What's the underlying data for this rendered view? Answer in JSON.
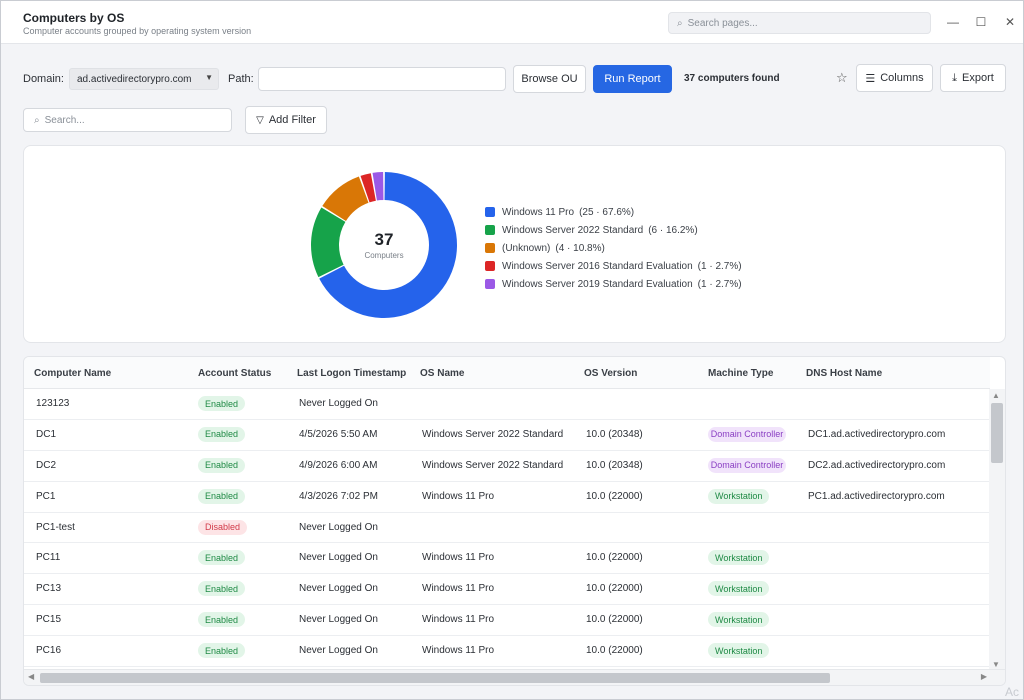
{
  "window": {
    "title": "Computers by OS",
    "subtitle": "Computer accounts grouped by operating system version",
    "search_placeholder": "Search pages...",
    "controls": {
      "minimize": "—",
      "maximize": "☐",
      "close": "✕"
    }
  },
  "toolbar": {
    "domain_label": "Domain:",
    "domain_value": "ad.activedirectorypro.com",
    "path_label": "Path:",
    "path_value": "",
    "browse_label": "Browse OU",
    "run_label": "Run Report",
    "found_text": "37 computers found",
    "columns_label": "Columns",
    "export_label": "Export",
    "search_placeholder": "Search...",
    "add_filter_label": "Add Filter"
  },
  "chart_data": {
    "type": "pie",
    "style": "donut",
    "total": "37",
    "center_caption": "Computers",
    "slices": [
      {
        "label": "Windows 11 Pro",
        "value": 25,
        "detail": "(25 · 67.6%)",
        "color": "#2563eb"
      },
      {
        "label": "Windows Server 2022 Standard",
        "value": 6,
        "detail": "(6 · 16.2%)",
        "color": "#16a34a"
      },
      {
        "label": "(Unknown)",
        "value": 4,
        "detail": "(4 · 10.8%)",
        "color": "#d97706"
      },
      {
        "label": "Windows Server 2016 Standard Evaluation",
        "value": 1,
        "detail": "(1 · 2.7%)",
        "color": "#dc2626"
      },
      {
        "label": "Windows Server 2019 Standard Evaluation",
        "value": 1,
        "detail": "(1 · 2.7%)",
        "color": "#9b59e6"
      }
    ],
    "legend_position": "right"
  },
  "table": {
    "columns": [
      "Computer Name",
      "Account Status",
      "Last Logon Timestamp",
      "OS Name",
      "OS Version",
      "Machine Type",
      "DNS Host Name"
    ],
    "rows": [
      {
        "name": "123123",
        "status": "Enabled",
        "logon": "Never Logged On",
        "os": "",
        "version": "",
        "type": "",
        "dns": ""
      },
      {
        "name": "DC1",
        "status": "Enabled",
        "logon": "4/5/2026 5:50 AM",
        "os": "Windows Server 2022 Standard",
        "version": "10.0 (20348)",
        "type": "Domain Controller",
        "dns": "DC1.ad.activedirectorypro.com"
      },
      {
        "name": "DC2",
        "status": "Enabled",
        "logon": "4/9/2026 6:00 AM",
        "os": "Windows Server 2022 Standard",
        "version": "10.0 (20348)",
        "type": "Domain Controller",
        "dns": "DC2.ad.activedirectorypro.com"
      },
      {
        "name": "PC1",
        "status": "Enabled",
        "logon": "4/3/2026 7:02 PM",
        "os": "Windows 11 Pro",
        "version": "10.0 (22000)",
        "type": "Workstation",
        "dns": "PC1.ad.activedirectorypro.com"
      },
      {
        "name": "PC1-test",
        "status": "Disabled",
        "logon": "Never Logged On",
        "os": "",
        "version": "",
        "type": "",
        "dns": ""
      },
      {
        "name": "PC11",
        "status": "Enabled",
        "logon": "Never Logged On",
        "os": "Windows 11 Pro",
        "version": "10.0 (22000)",
        "type": "Workstation",
        "dns": ""
      },
      {
        "name": "PC13",
        "status": "Enabled",
        "logon": "Never Logged On",
        "os": "Windows 11 Pro",
        "version": "10.0 (22000)",
        "type": "Workstation",
        "dns": ""
      },
      {
        "name": "PC15",
        "status": "Enabled",
        "logon": "Never Logged On",
        "os": "Windows 11 Pro",
        "version": "10.0 (22000)",
        "type": "Workstation",
        "dns": ""
      },
      {
        "name": "PC16",
        "status": "Enabled",
        "logon": "Never Logged On",
        "os": "Windows 11 Pro",
        "version": "10.0 (22000)",
        "type": "Workstation",
        "dns": ""
      }
    ]
  },
  "watermark": "Ac",
  "icons": {
    "search": "search-icon",
    "star": "star-icon",
    "columns": "columns-icon",
    "export": "download-icon",
    "filter": "filter-icon"
  }
}
